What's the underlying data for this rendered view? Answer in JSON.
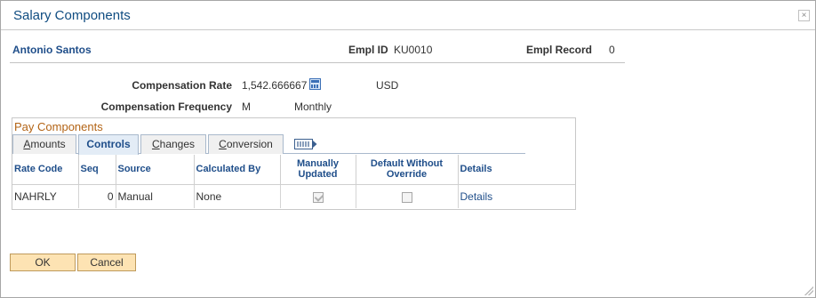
{
  "dialog": {
    "title": "Salary Components",
    "close_glyph": "×"
  },
  "header": {
    "employee_name": "Antonio Santos",
    "empl_id_label": "Empl ID",
    "empl_id_value": "KU0010",
    "empl_record_label": "Empl Record",
    "empl_record_value": "0"
  },
  "compensation": {
    "rate_label": "Compensation Rate",
    "rate_value": "1,542.666667",
    "currency": "USD",
    "frequency_label": "Compensation Frequency",
    "frequency_code": "M",
    "frequency_desc": "Monthly"
  },
  "pay_components": {
    "title": "Pay Components",
    "tabs": [
      {
        "label_u": "A",
        "label_rest": "mounts"
      },
      {
        "label_u": "",
        "label_rest": "Controls"
      },
      {
        "label_u": "C",
        "label_rest": "hanges"
      },
      {
        "label_u": "C",
        "label_rest": "onversion"
      }
    ],
    "more_tabs_icon": "show-all-columns-icon",
    "columns": [
      "Rate Code",
      "Seq",
      "Source",
      "Calculated By",
      "Manually Updated",
      "Default Without Override",
      "Details"
    ],
    "rows": [
      {
        "rate_code": "NAHRLY",
        "seq": "0",
        "source": "Manual",
        "calculated_by": "None",
        "manually_updated": true,
        "default_without_override": false,
        "details": "Details"
      }
    ]
  },
  "buttons": {
    "ok": "OK",
    "cancel": "Cancel"
  },
  "colors": {
    "link": "#1f4e8a",
    "section_title": "#b36416",
    "button_bg": "#fde3b3"
  }
}
